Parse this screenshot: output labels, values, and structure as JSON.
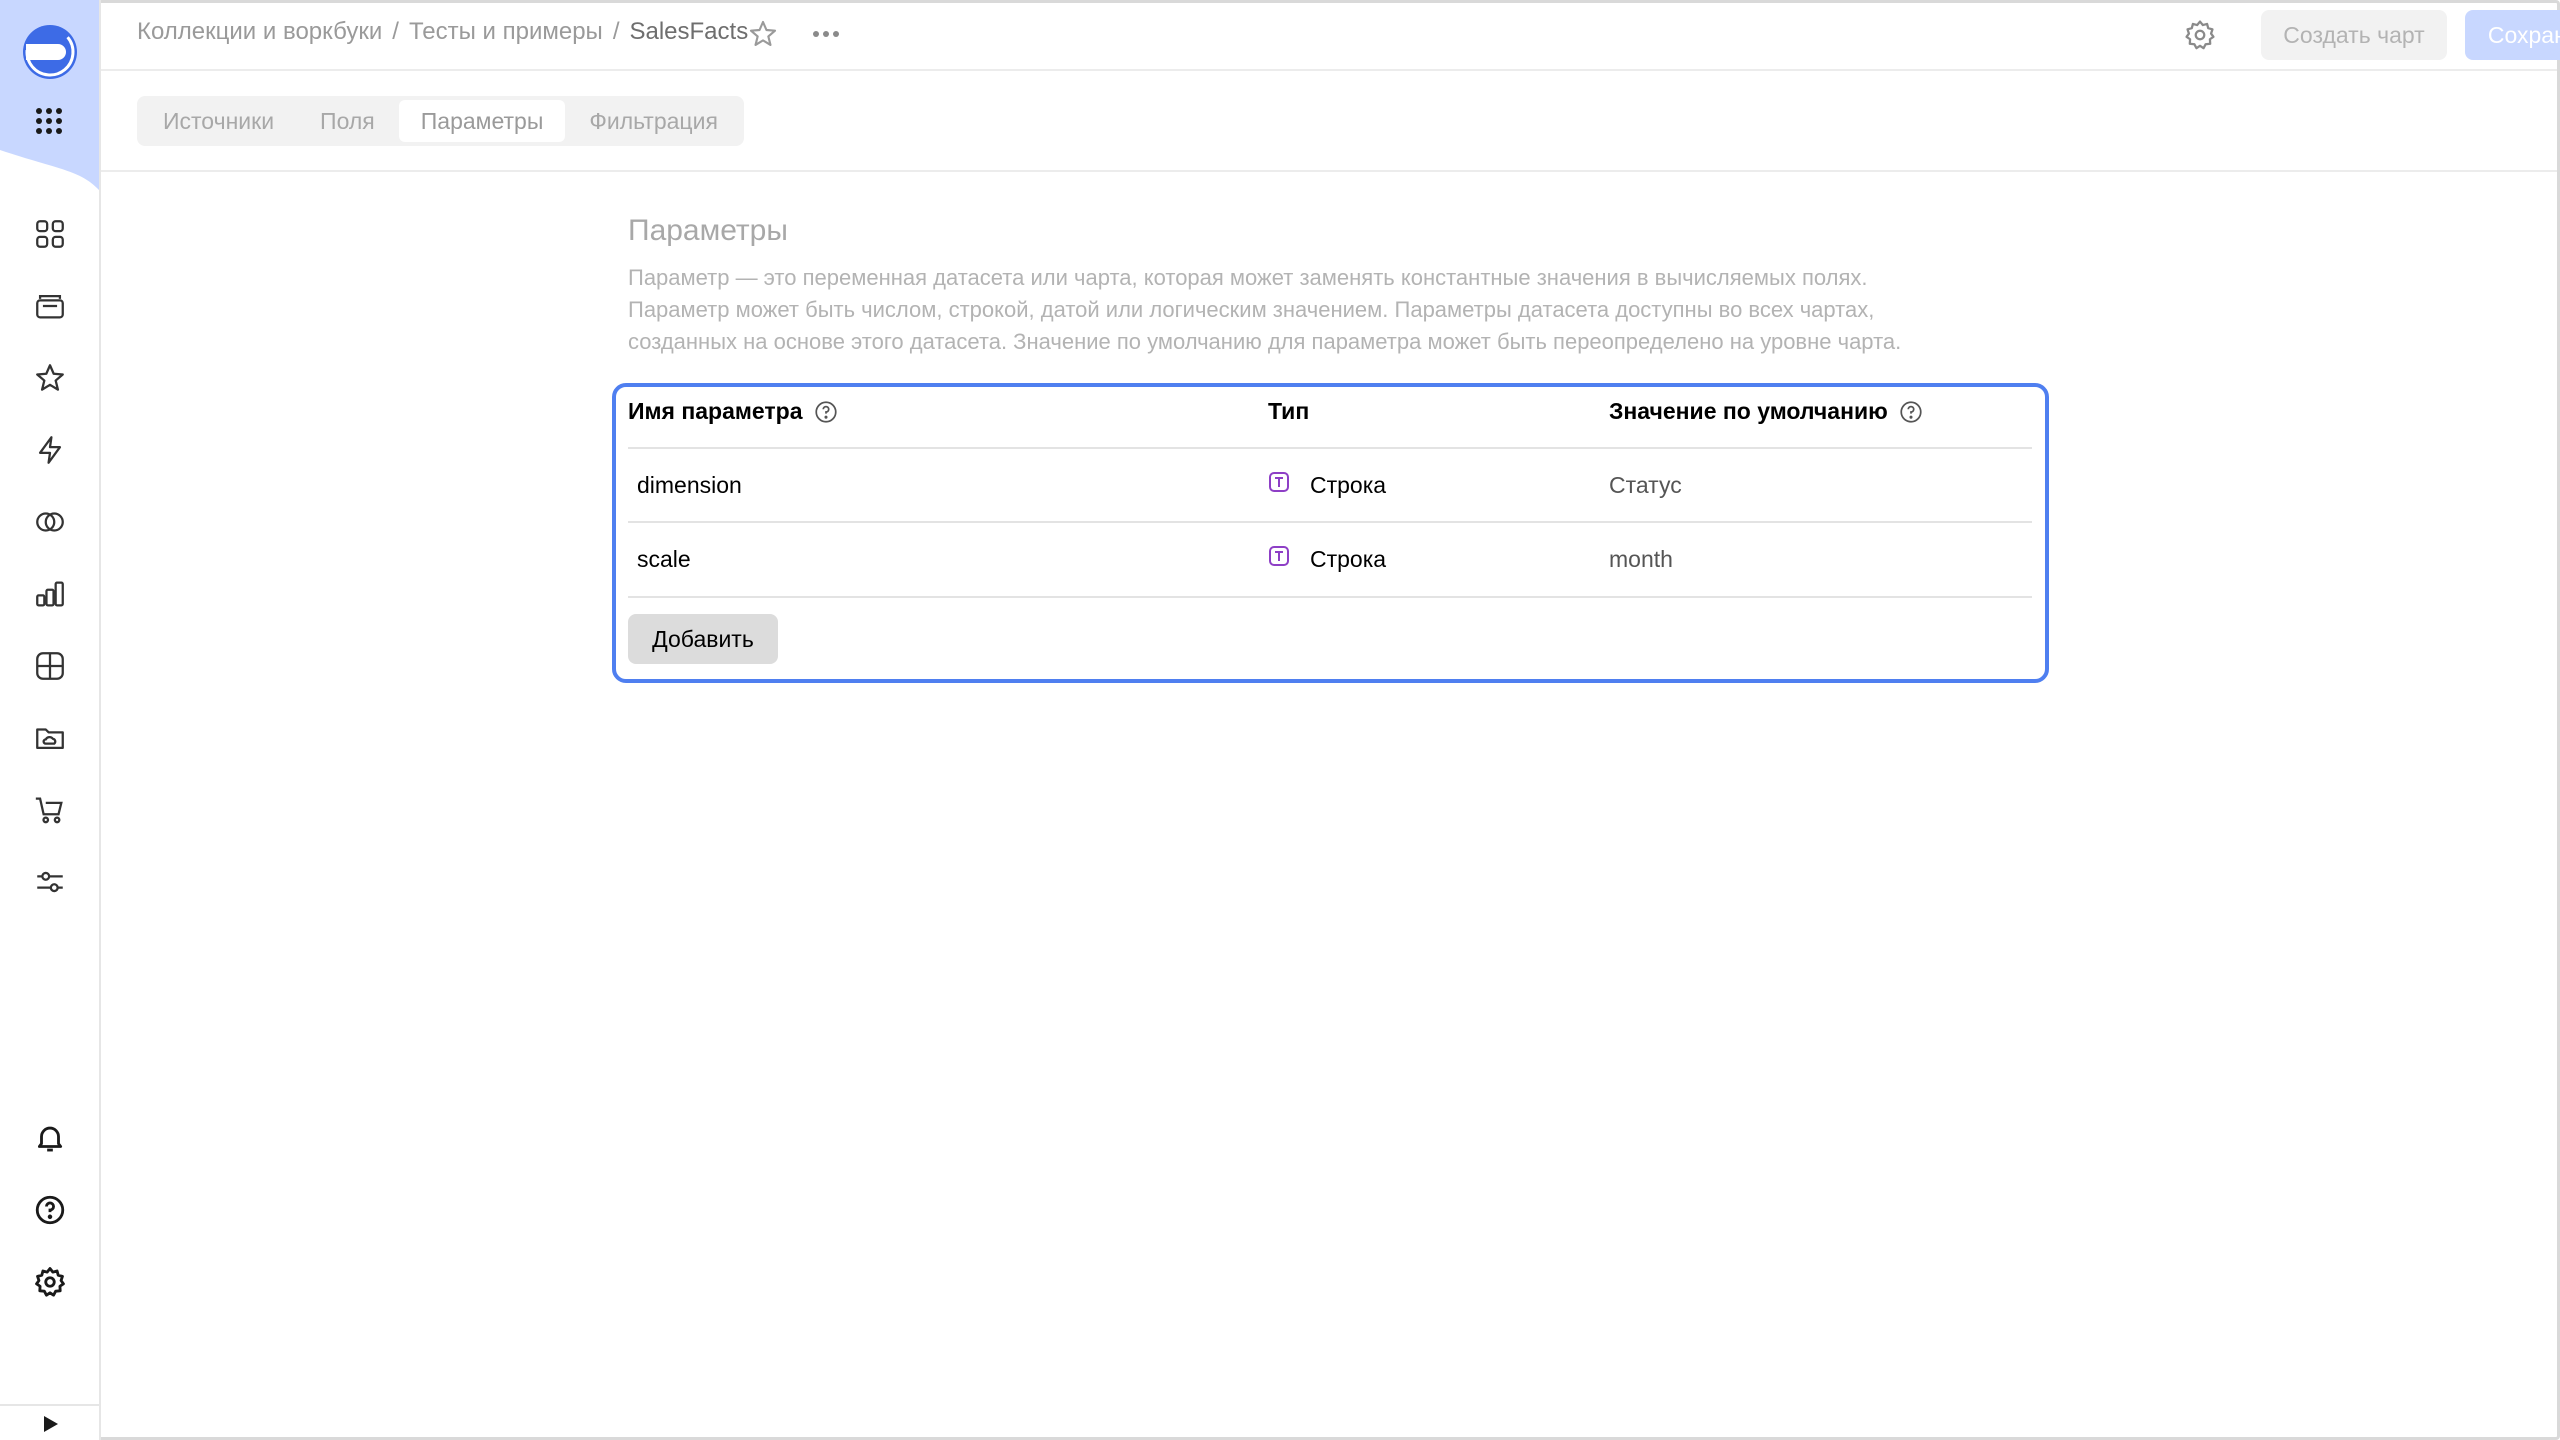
{
  "breadcrumbs": [
    {
      "label": "Коллекции и воркбуки"
    },
    {
      "label": "Тесты и примеры"
    },
    {
      "label": "SalesFacts"
    }
  ],
  "breadcrumb_separator": "/",
  "header": {
    "create_chart_label": "Создать чарт",
    "save_label": "Сохранить"
  },
  "tabs": [
    {
      "label": "Источники",
      "active": false
    },
    {
      "label": "Поля",
      "active": false
    },
    {
      "label": "Параметры",
      "active": true
    },
    {
      "label": "Фильтрация",
      "active": false
    }
  ],
  "parameters_section": {
    "title": "Параметры",
    "description_lines": [
      "Параметр — это переменная датасета или чарта, которая может заменять константные значения в вычисляемых полях.",
      "Параметр может быть числом, строкой, датой или логическим значением. Параметры датасета доступны во всех чартах,",
      "созданных на основе этого датасета. Значение по умолчанию для параметра может быть переопределено на уровне чарта."
    ],
    "columns": {
      "name": "Имя параметра",
      "type": "Тип",
      "default": "Значение по умолчанию"
    },
    "rows": [
      {
        "name": "dimension",
        "type": "Строка",
        "default": "Статус"
      },
      {
        "name": "scale",
        "type": "Строка",
        "default": "month"
      }
    ],
    "add_label": "Добавить"
  },
  "colors": {
    "accent": "#4f7ff0",
    "brand": "#3d6be6",
    "type_icon": "#8e3fc6"
  },
  "icons": {
    "sidebar": [
      "collections-icon",
      "folder-stack-icon",
      "star-icon",
      "lightning-icon",
      "connections-icon",
      "chart-icon",
      "grid-icon",
      "folder-cloud-icon",
      "cart-icon",
      "sliders-icon"
    ],
    "sidebar_bottom": [
      "bell-icon",
      "help-icon",
      "settings-icon"
    ]
  }
}
